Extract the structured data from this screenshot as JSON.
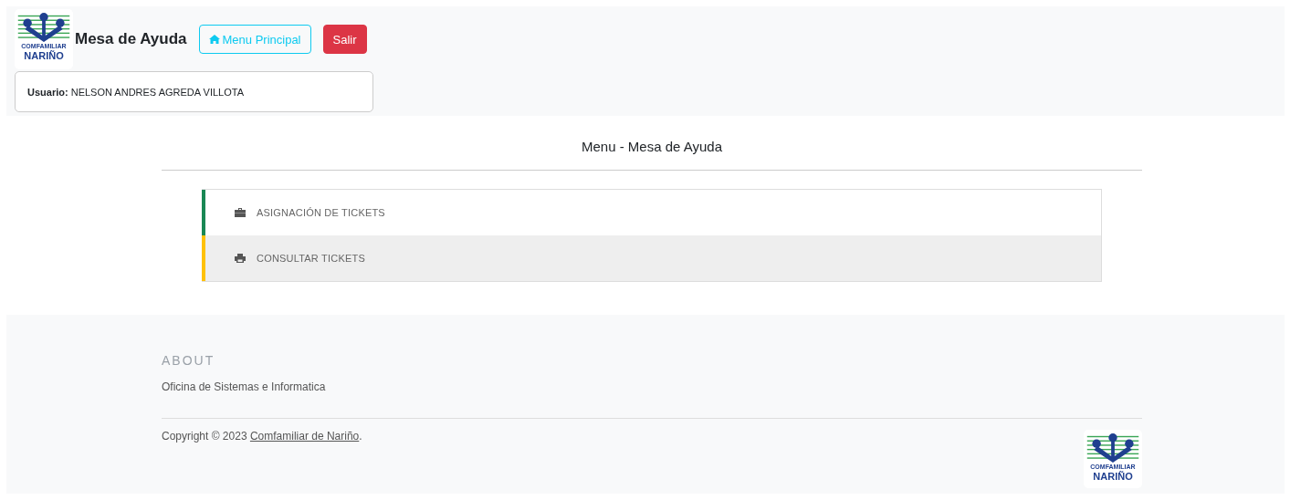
{
  "header": {
    "logo": {
      "line1": "COMFAMILIAR",
      "line2": "NARIÑO"
    },
    "title": "Mesa de Ayuda",
    "buttons": [
      {
        "kind": "outline",
        "label": "Menu Principal"
      },
      {
        "kind": "danger",
        "label": "Salir"
      }
    ],
    "user": {
      "label": "Usuario:",
      "name": "NELSON ANDRES AGREDA VILLOTA"
    }
  },
  "menu": {
    "title": "Menu - Mesa de Ayuda",
    "items": [
      {
        "label": "ASIGNACIÓN DE TICKETS",
        "kind": "briefcase",
        "color": "#198754",
        "selected": false
      },
      {
        "label": "CONSULTAR TICKETS",
        "kind": "printer",
        "color": "#ffc107",
        "selected": true
      }
    ]
  },
  "footer": {
    "heading": "ABOUT",
    "text": "Oficina de Sistemas e Informatica",
    "copyright": "Copyright © 2023",
    "link": "Comfamiliar de Nariño",
    "after_link": ".",
    "logo": {
      "line1": "COMFAMILIAR",
      "line2": "NARIÑO"
    }
  }
}
